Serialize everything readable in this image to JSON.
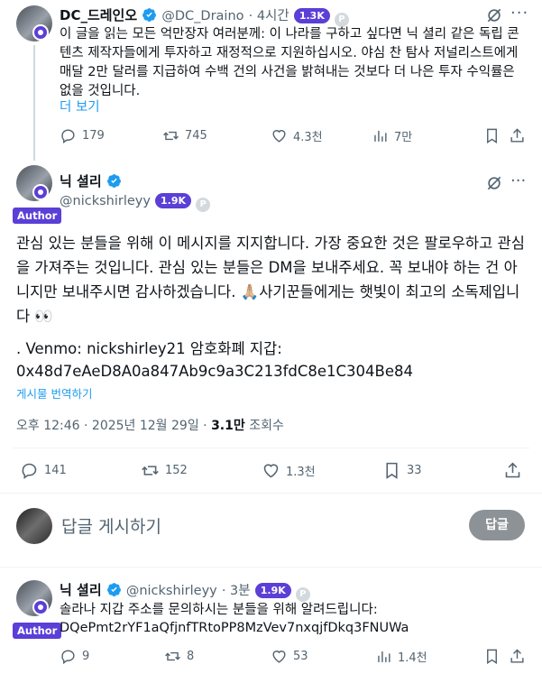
{
  "post1": {
    "name": "DC_드레인오",
    "handle": "@DC_Draino",
    "time": "· 4시간",
    "followers_badge": "1.3K",
    "body": "이 글을 읽는 모든 억만장자 여러분께: 이 나라를 구하고 싶다면 닉 셜리 같은 독립 콘텐츠 제작자들에게 투자하고 재정적으로 지원하십시오. 야심 찬 탐사 저널리스트에게 매달 2만 달러를 지급하여 수백 건의 사건을 밝혀내는 것보다 더 나은 투자 수익률은 없을 것입니다.",
    "more": "더 보기",
    "replies": "179",
    "reposts": "745",
    "likes": "4.3천",
    "views": "7만"
  },
  "post2": {
    "name": "닉 셜리",
    "handle": "@nickshirleyy",
    "followers_badge": "1.9K",
    "author_tag": "Author",
    "body_line1": "관심 있는 분들을 위해 이 메시지를 지지합니다. 가장 중요한 것은 팔로우하고 관심을 가져주는 것입니다. 관심 있는 분들은 DM을 보내주세요. 꼭 보내야 하는 건 아니지만 보내주시면 감사하겠습니다. 🙏🏼사기꾼들에게는 햇빛이 최고의 소독제입니다  👀",
    "body_line2": ". Venmo: nickshirley21 암호화폐 지갑:",
    "body_line3": "0x48d7eAeD8A0a847Ab9c9a3C213fdC8e1C304Be84",
    "translate": "게시물 번역하기",
    "meta_time": "오후 12:46 · 2025년 12월 29일 · ",
    "meta_views_num": "3.1만",
    "meta_views_label": " 조회수",
    "replies": "141",
    "reposts": "152",
    "likes": "1.3천",
    "bookmarks": "33"
  },
  "reply_box": {
    "placeholder": "답글 게시하기",
    "button": "답글"
  },
  "post3": {
    "name": "닉 셜리",
    "handle": "@nickshirleyy",
    "time": "· 3분",
    "followers_badge": "1.9K",
    "author_tag": "Author",
    "body_line1": "솔라나 지갑 주소를 문의하시는 분들을 위해 알려드립니다:",
    "body_line2": "DQePmt2rYF1aQfjnfTRtoPP8MzVev7nxqjfDkq3FNUWa",
    "replies": "9",
    "reposts": "8",
    "likes": "53",
    "views": "1.4천"
  },
  "colors": {
    "accent": "#1d9bf0",
    "badge_purple": "#5b3fd6",
    "muted": "#536471"
  }
}
